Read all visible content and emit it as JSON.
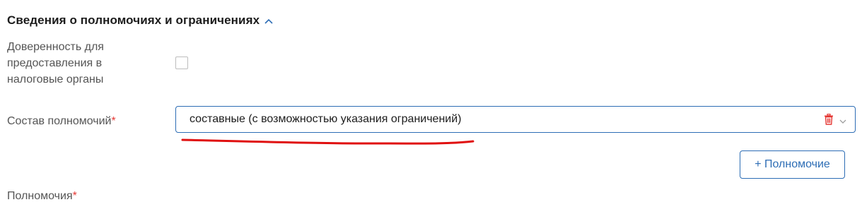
{
  "section": {
    "title": "Сведения о полномочиях и ограничениях",
    "toggle_icon": "chevron-up-icon"
  },
  "fields": {
    "tax_proxy": {
      "label": "Доверенность для предоставления в налоговые органы",
      "checked": false
    },
    "powers_composition": {
      "label": "Состав полномочий",
      "required_mark": "*",
      "value": "составные (с возможностью указания ограничений)",
      "clear_icon": "trash-icon",
      "dropdown_icon": "chevron-down-icon"
    },
    "authorities": {
      "label": "Полномочия",
      "required_mark": "*"
    }
  },
  "actions": {
    "add_authority_label": "+ Полномочие"
  },
  "colors": {
    "accent": "#2d6db5",
    "required": "#e53935",
    "trash": "#e53935",
    "annotation_underline": "#e01010",
    "label": "#555555"
  }
}
